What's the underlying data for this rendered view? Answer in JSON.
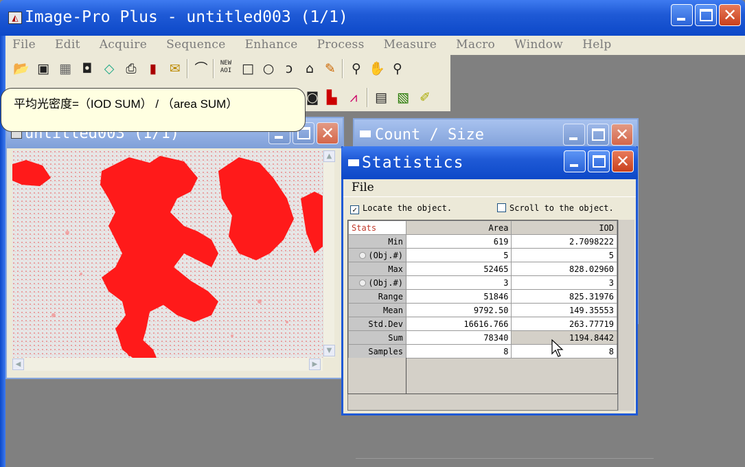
{
  "app": {
    "title": "Image-Pro Plus - untitled003 (1/1)",
    "menu": [
      "File",
      "Edit",
      "Acquire",
      "Sequence",
      "Enhance",
      "Process",
      "Measure",
      "Macro",
      "Window",
      "Help"
    ],
    "toolbar_new_aoi_label": "NEW\nAOI"
  },
  "callout": {
    "text": "平均光密度=（IOD SUM） / （area SUM）"
  },
  "image_window": {
    "title": "untitled003 (1/1)"
  },
  "count_window": {
    "title": "Count / Size"
  },
  "stats_window": {
    "title": "Statistics",
    "menu_file": "File",
    "locate_label": "Locate the object.",
    "locate_checked": true,
    "scroll_label": "Scroll to the object.",
    "scroll_checked": false,
    "headers": [
      "Stats",
      "Area",
      "IOD"
    ],
    "rows": [
      {
        "label": "Min",
        "area": "619",
        "iod": "2.7098222",
        "objicon": false
      },
      {
        "label": "(Obj.#)",
        "area": "5",
        "iod": "5",
        "objicon": true
      },
      {
        "label": "Max",
        "area": "52465",
        "iod": "828.02960",
        "objicon": false
      },
      {
        "label": "(Obj.#)",
        "area": "3",
        "iod": "3",
        "objicon": true
      },
      {
        "label": "Range",
        "area": "51846",
        "iod": "825.31976",
        "objicon": false
      },
      {
        "label": "Mean",
        "area": "9792.50",
        "iod": "149.35553",
        "objicon": false
      },
      {
        "label": "Std.Dev",
        "area": "16616.766",
        "iod": "263.77719",
        "objicon": false
      },
      {
        "label": "Sum",
        "area": "78340",
        "iod": "1194.8442",
        "objicon": false
      },
      {
        "label": "Samples",
        "area": "8",
        "iod": "8",
        "objicon": false
      }
    ],
    "selected_cell": "Sum/IOD"
  },
  "colors": {
    "xp_blue": "#1f5ad6",
    "stain_red": "#ff1a1a",
    "grey_bg": "#808080"
  }
}
